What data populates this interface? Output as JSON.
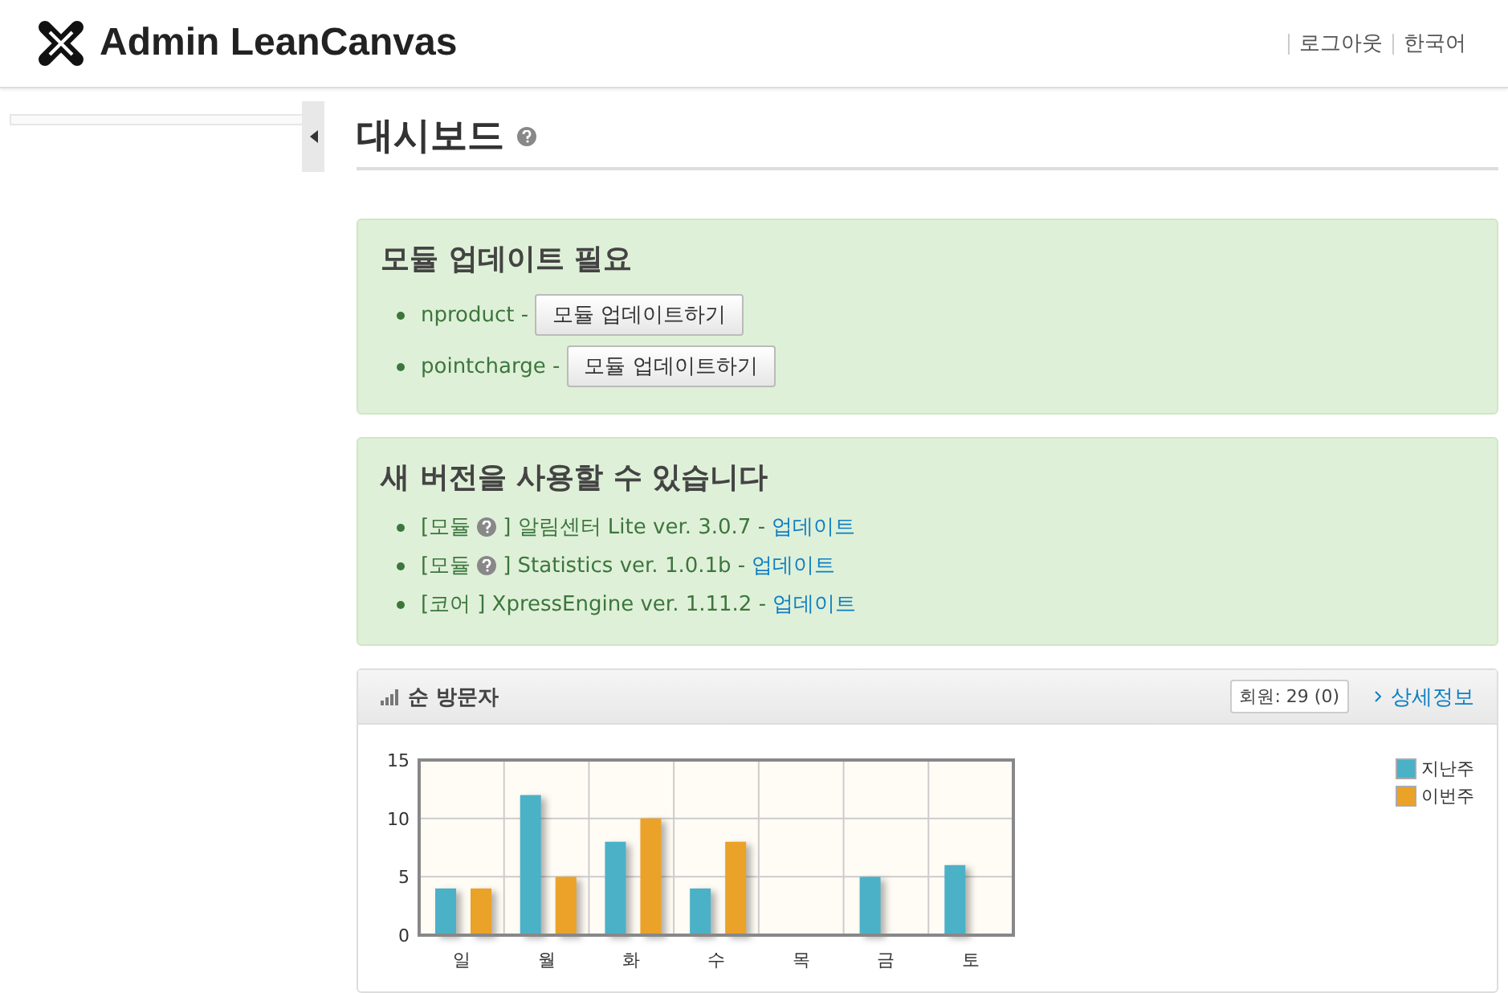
{
  "header": {
    "title": "Admin LeanCanvas",
    "links": [
      "로그아웃",
      "한국어"
    ]
  },
  "page": {
    "title": "대시보드"
  },
  "module_updates": {
    "title": "모듈 업데이트 필요",
    "items": [
      {
        "name": "nproduct -",
        "button": "모듈 업데이트하기"
      },
      {
        "name": "pointcharge -",
        "button": "모듈 업데이트하기"
      }
    ]
  },
  "new_versions": {
    "title": "새 버전을 사용할 수 있습니다",
    "items": [
      {
        "prefix": "[모듈",
        "help": true,
        "text": "] 알림센터 Lite ver. 3.0.7 -",
        "link": "업데이트"
      },
      {
        "prefix": "[모듈",
        "help": true,
        "text": "] Statistics ver. 1.0.1b -",
        "link": "업데이트"
      },
      {
        "prefix": "[코어",
        "help": false,
        "text": "] XpressEngine ver. 1.11.2 -",
        "link": "업데이트"
      }
    ]
  },
  "visitors": {
    "title": "순 방문자",
    "members": "회원: 29 (0)",
    "detail_link": "상세정보",
    "chart_data": {
      "type": "bar",
      "categories": [
        "일",
        "월",
        "화",
        "수",
        "목",
        "금",
        "토"
      ],
      "series": [
        {
          "name": "지난주",
          "color": "#4bb1c6",
          "values": [
            4,
            12,
            8,
            4,
            0,
            5,
            6
          ]
        },
        {
          "name": "이번주",
          "color": "#eba228",
          "values": [
            4,
            5,
            10,
            8,
            0,
            0,
            0
          ]
        }
      ],
      "ylim": [
        0,
        15
      ],
      "yticks": [
        0,
        5,
        10,
        15
      ]
    }
  }
}
